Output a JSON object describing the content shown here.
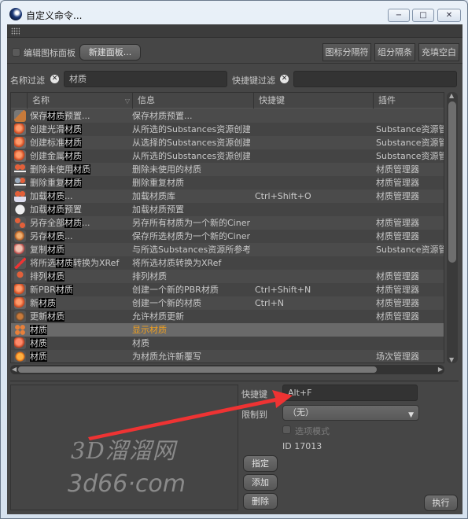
{
  "window": {
    "title": "自定义命令...",
    "controls": {
      "minimize": "−",
      "maximize": "□",
      "close": "✕"
    }
  },
  "toolbar": {
    "edit_palette_label": "编辑图标面板",
    "new_palette_button": "新建面板...",
    "icon_separator_button": "图标分隔符",
    "group_separator_button": "组分隔条",
    "fill_space_button": "充填空白"
  },
  "filters": {
    "name_filter_label": "名称过滤",
    "name_filter_value": "材质",
    "shortcut_filter_label": "快捷键过滤",
    "shortcut_filter_value": ""
  },
  "table": {
    "columns": [
      "名称",
      "信息",
      "快捷键",
      "插件"
    ],
    "rows": [
      {
        "icon": "save-preset-icon",
        "name_pre": "保存",
        "name_hl": "材质",
        "name_post": "预置...",
        "info": "保存材质预置...",
        "shortcut": "",
        "plugin": ""
      },
      {
        "icon": "create-material-icon",
        "name_pre": "创建光滑",
        "name_hl": "材质",
        "name_post": "",
        "info": "从所选的Substances资源创建光",
        "shortcut": "",
        "plugin": "Substance资源管理"
      },
      {
        "icon": "create-material-icon",
        "name_pre": "创建标准",
        "name_hl": "材质",
        "name_post": "",
        "info": "从选择的Substances资源创建标",
        "shortcut": "",
        "plugin": "Substance资源管理"
      },
      {
        "icon": "create-material-icon",
        "name_pre": "创建金属",
        "name_hl": "材质",
        "name_post": "",
        "info": "从所选的Substances资源创建金",
        "shortcut": "",
        "plugin": "Substance资源管理"
      },
      {
        "icon": "remove-unused-icon",
        "name_pre": "删除未使用",
        "name_hl": "材质",
        "name_post": "",
        "info": "删除未使用的材质",
        "shortcut": "",
        "plugin": "材质管理器"
      },
      {
        "icon": "remove-duplicate-icon",
        "name_pre": "删除重复",
        "name_hl": "材质",
        "name_post": "",
        "info": "删除重复材质",
        "shortcut": "",
        "plugin": "材质管理器"
      },
      {
        "icon": "load-material-icon",
        "name_pre": "加载",
        "name_hl": "材质",
        "name_post": "...",
        "info": "加载材质库",
        "shortcut": "Ctrl+Shift+O",
        "plugin": "材质管理器"
      },
      {
        "icon": "gear-icon",
        "name_pre": "加载",
        "name_hl": "材质",
        "name_post": "预置",
        "info": "加载材质预置",
        "shortcut": "",
        "plugin": ""
      },
      {
        "icon": "save-all-icon",
        "name_pre": "另存全部",
        "name_hl": "材质",
        "name_post": "...",
        "info": "另存所有材质为一个新的Cinen",
        "shortcut": "",
        "plugin": "材质管理器"
      },
      {
        "icon": "save-as-icon",
        "name_pre": "另存",
        "name_hl": "材质",
        "name_post": "...",
        "info": "保存所选材质为一个新的Cinen",
        "shortcut": "",
        "plugin": "材质管理器"
      },
      {
        "icon": "copy-material-icon",
        "name_pre": "复制",
        "name_hl": "材质",
        "name_post": "",
        "info": "与所选Substances资源所参考的",
        "shortcut": "",
        "plugin": "Substance资源管理"
      },
      {
        "icon": "xref-convert-icon",
        "name_pre": "将所选",
        "name_hl": "材质",
        "name_post": "转换为XRef",
        "info": "将所选材质转换为XRef",
        "shortcut": "",
        "plugin": ""
      },
      {
        "icon": "sort-az-icon",
        "name_pre": "排列",
        "name_hl": "材质",
        "name_post": "",
        "info": "排列材质",
        "shortcut": "",
        "plugin": "材质管理器"
      },
      {
        "icon": "new-pbr-icon",
        "name_pre": "新PBR",
        "name_hl": "材质",
        "name_post": "",
        "info": "创建一个新的PBR材质",
        "shortcut": "Ctrl+Shift+N",
        "plugin": "材质管理器"
      },
      {
        "icon": "new-material-icon",
        "name_pre": "新",
        "name_hl": "材质",
        "name_post": "",
        "info": "创建一个新的材质",
        "shortcut": "Ctrl+N",
        "plugin": "材质管理器"
      },
      {
        "icon": "update-material-icon",
        "name_pre": "更新",
        "name_hl": "材质",
        "name_post": "",
        "info": "允许材质更新",
        "shortcut": "",
        "plugin": "材质管理器"
      },
      {
        "icon": "show-materials-icon",
        "name_pre": "",
        "name_hl": "材质",
        "name_post": "",
        "info": "显示材质",
        "shortcut": "",
        "plugin": "",
        "selected": true
      },
      {
        "icon": "material-preview-icon",
        "name_pre": "",
        "name_hl": "材质",
        "name_post": "",
        "info": "材质",
        "shortcut": "",
        "plugin": ""
      },
      {
        "icon": "material-override-icon",
        "name_pre": "",
        "name_hl": "材质",
        "name_post": "",
        "info": "为材质允许新覆写",
        "shortcut": "",
        "plugin": "场次管理器"
      }
    ]
  },
  "details": {
    "shortcut_label": "快捷键",
    "shortcut_value": "Alt+F",
    "restrict_label": "限制到",
    "restrict_value": "（无）",
    "option_mode_label": "选项模式",
    "id_text": "ID 17013",
    "assign_button": "指定",
    "add_button": "添加",
    "delete_button": "删除",
    "execute_button": "执行"
  },
  "watermark": {
    "line1": "3D溜溜网",
    "line2": "3d66·com"
  },
  "colors": {
    "highlight_info": "#f0a020",
    "annotation_arrow": "#ee3333"
  }
}
